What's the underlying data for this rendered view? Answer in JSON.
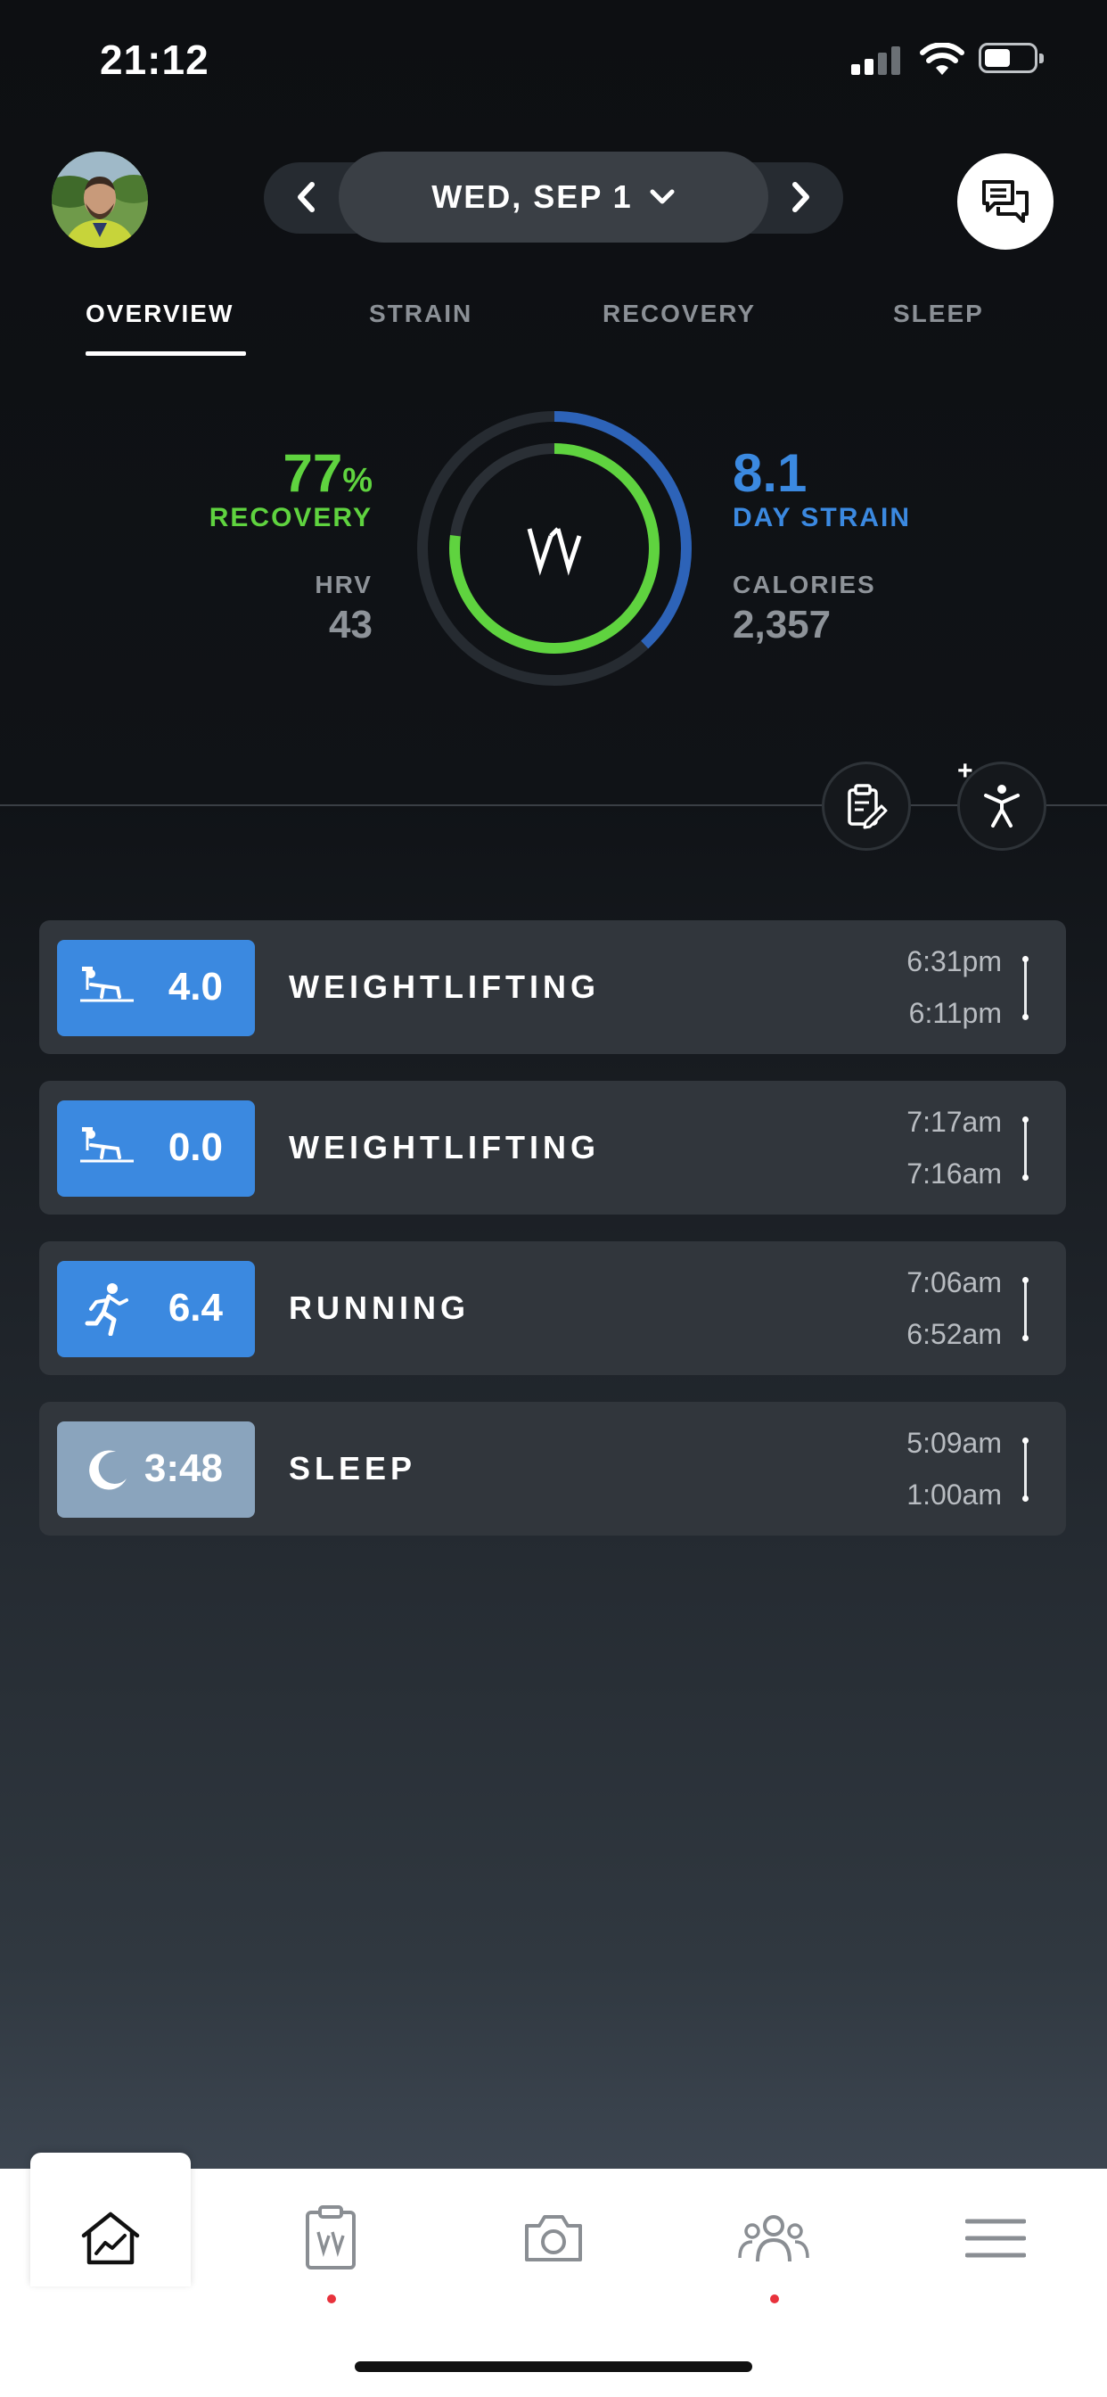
{
  "status_bar": {
    "time": "21:12"
  },
  "header": {
    "date": "WED, SEP 1"
  },
  "tabs": [
    {
      "label": "OVERVIEW",
      "active": true
    },
    {
      "label": "STRAIN",
      "active": false
    },
    {
      "label": "RECOVERY",
      "active": false
    },
    {
      "label": "SLEEP",
      "active": false
    }
  ],
  "overview": {
    "recovery_value": "77",
    "recovery_unit": "%",
    "recovery_label": "RECOVERY",
    "hrv_label": "HRV",
    "hrv_value": "43",
    "strain_value": "8.1",
    "strain_label": "DAY STRAIN",
    "calories_label": "CALORIES",
    "calories_value": "2,357",
    "ring_logo": "W",
    "recovery_fraction": 0.77,
    "strain_fraction": 0.38
  },
  "activities": [
    {
      "icon": "weightlifting-icon",
      "value": "4.0",
      "title": "WEIGHTLIFTING",
      "end": "6:31pm",
      "start": "6:11pm"
    },
    {
      "icon": "weightlifting-icon",
      "value": "0.0",
      "title": "WEIGHTLIFTING",
      "end": "7:17am",
      "start": "7:16am"
    },
    {
      "icon": "running-icon",
      "value": "6.4",
      "title": "RUNNING",
      "end": "7:06am",
      "start": "6:52am"
    },
    {
      "icon": "moon-icon",
      "value": "3:48",
      "title": "SLEEP",
      "end": "5:09am",
      "start": "1:00am"
    }
  ],
  "colors": {
    "recovery_green": "#5fd33f",
    "strain_blue": "#3b89e0",
    "sleep_badge": "#8aa4bd",
    "notification_dot": "#e8323c"
  },
  "bottom_nav": [
    "home-icon",
    "journal-icon",
    "camera-icon",
    "community-icon",
    "menu-icon"
  ]
}
